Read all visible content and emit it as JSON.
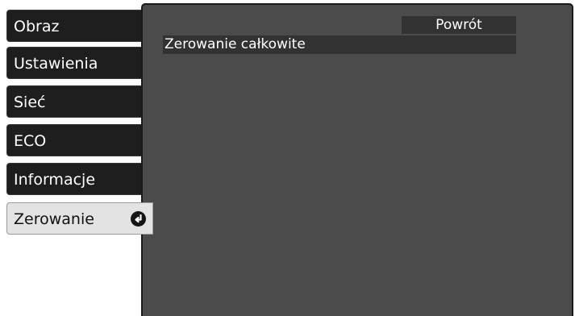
{
  "sidebar": {
    "items": [
      {
        "label": "Obraz"
      },
      {
        "label": "Ustawienia"
      },
      {
        "label": "Sieć"
      },
      {
        "label": "ECO"
      },
      {
        "label": "Informacje"
      },
      {
        "label": "Zerowanie",
        "selected": true,
        "icon": "enter-icon"
      }
    ]
  },
  "main": {
    "back_label": "Powrót",
    "items": [
      {
        "label": "Zerowanie całkowite"
      }
    ]
  },
  "colors": {
    "panel_bg": "#4b4b4b",
    "tab_bg": "#1e1e1e",
    "active_tab_bg": "#e3e3e3",
    "item_bg": "#323232"
  }
}
